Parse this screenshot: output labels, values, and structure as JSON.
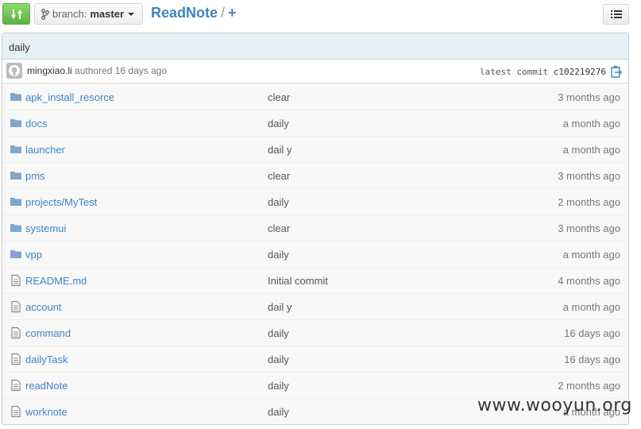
{
  "header": {
    "branch_label": "branch:",
    "branch_name": "master",
    "repo_name": "ReadNote",
    "separator": "/",
    "new_file": "+"
  },
  "commit": {
    "message": "daily",
    "author": "mingxiao.li",
    "authored_text": "authored 16 days ago",
    "latest_label": "latest commit",
    "sha": "c102219276"
  },
  "files": [
    {
      "type": "folder",
      "name": "apk_install_resorce",
      "message": "clear",
      "age": "3 months ago"
    },
    {
      "type": "folder",
      "name": "docs",
      "message": "daily",
      "age": "a month ago"
    },
    {
      "type": "folder",
      "name": "launcher",
      "message": "dail y",
      "age": "a month ago"
    },
    {
      "type": "folder",
      "name": "pms",
      "message": "clear",
      "age": "3 months ago"
    },
    {
      "type": "folder",
      "name": "projects/MyTest",
      "message": "daily",
      "age": "2 months ago"
    },
    {
      "type": "folder",
      "name": "systemui",
      "message": "clear",
      "age": "3 months ago"
    },
    {
      "type": "folder",
      "name": "vpp",
      "message": "daily",
      "age": "a month ago"
    },
    {
      "type": "file",
      "name": "README.md",
      "message": "Initial commit",
      "age": "4 months ago"
    },
    {
      "type": "file",
      "name": "account",
      "message": "dail y",
      "age": "a month ago"
    },
    {
      "type": "file",
      "name": "command",
      "message": "daily",
      "age": "16 days ago"
    },
    {
      "type": "file",
      "name": "dailyTask",
      "message": "daily",
      "age": "16 days ago"
    },
    {
      "type": "file",
      "name": "readNote",
      "message": "daily",
      "age": "2 months ago"
    },
    {
      "type": "file",
      "name": "worknote",
      "message": "daily",
      "age": "a month ago"
    }
  ],
  "watermark": "www.wooyun.org",
  "colors": {
    "link": "#4183c4",
    "folder": "#80a6cd",
    "compare_green": "#60b044"
  }
}
